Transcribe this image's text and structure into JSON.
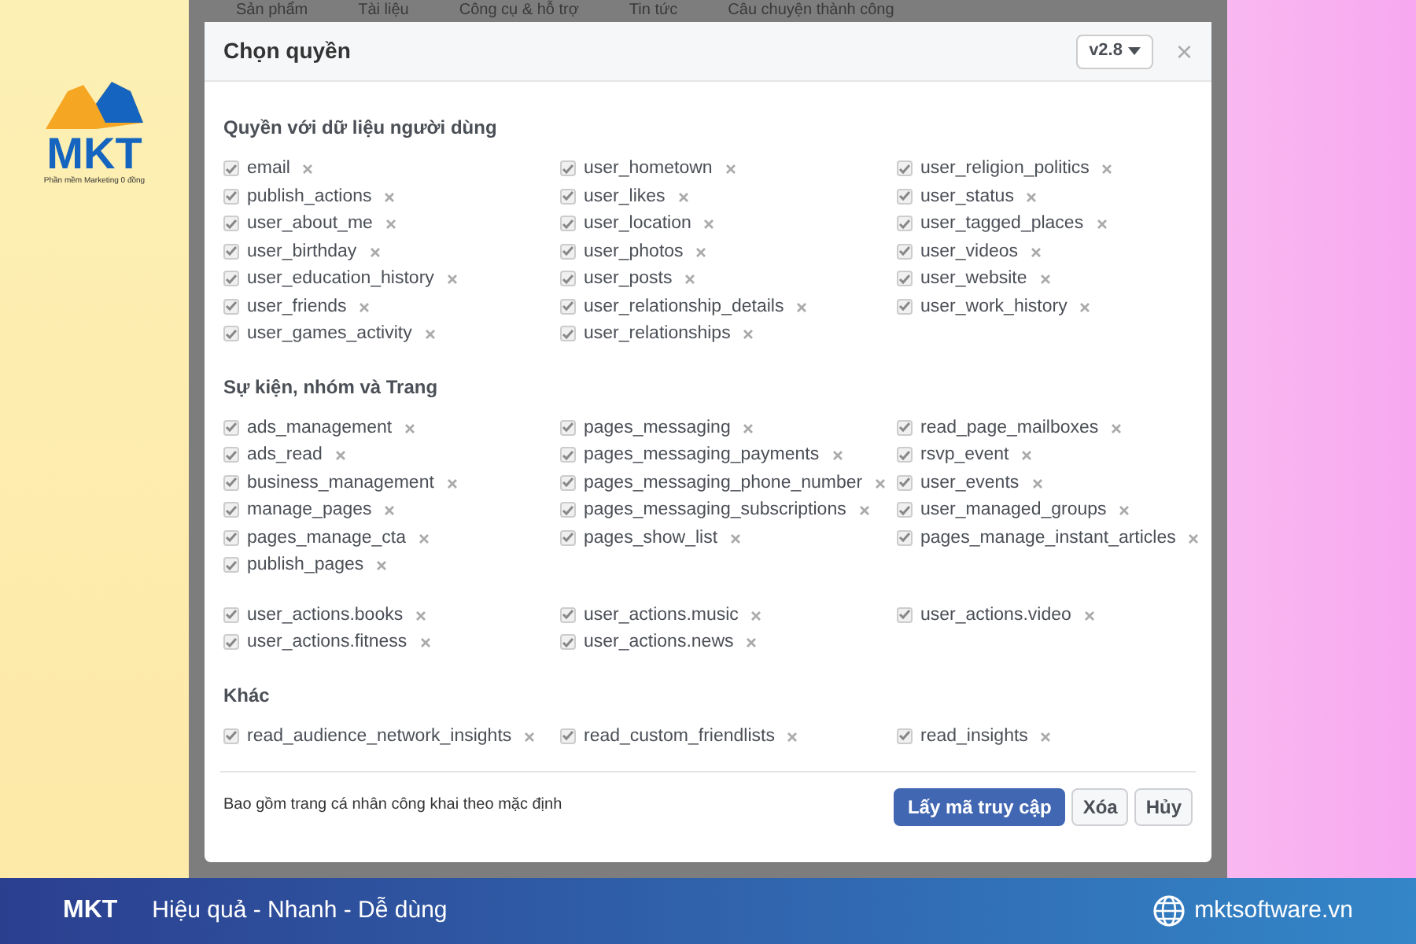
{
  "brand": {
    "logo_text": "MKT",
    "logo_tagline": "Phần mềm Marketing 0 đồng"
  },
  "background_nav": [
    "Sản phẩm",
    "Tài liệu",
    "Công cụ & hỗ trợ",
    "Tin tức",
    "Câu chuyện thành công"
  ],
  "dialog": {
    "title": "Chọn quyền",
    "version": "v2.8",
    "close": "×",
    "sections": [
      {
        "heading": "Quyền với dữ liệu người dùng",
        "items": [
          {
            "label": "email",
            "checked": true
          },
          {
            "label": "user_hometown",
            "checked": true
          },
          {
            "label": "user_religion_politics",
            "checked": true
          },
          {
            "label": "publish_actions",
            "checked": true
          },
          {
            "label": "user_likes",
            "checked": true
          },
          {
            "label": "user_status",
            "checked": true
          },
          {
            "label": "user_about_me",
            "checked": true
          },
          {
            "label": "user_location",
            "checked": true
          },
          {
            "label": "user_tagged_places",
            "checked": true
          },
          {
            "label": "user_birthday",
            "checked": true
          },
          {
            "label": "user_photos",
            "checked": true
          },
          {
            "label": "user_videos",
            "checked": true
          },
          {
            "label": "user_education_history",
            "checked": true
          },
          {
            "label": "user_posts",
            "checked": true
          },
          {
            "label": "user_website",
            "checked": true
          },
          {
            "label": "user_friends",
            "checked": true
          },
          {
            "label": "user_relationship_details",
            "checked": true
          },
          {
            "label": "user_work_history",
            "checked": true
          },
          {
            "label": "user_games_activity",
            "checked": true
          },
          {
            "label": "user_relationships",
            "checked": true
          }
        ]
      },
      {
        "heading": "Sự kiện, nhóm và Trang",
        "items": [
          {
            "label": "ads_management",
            "checked": true
          },
          {
            "label": "pages_messaging",
            "checked": true
          },
          {
            "label": "read_page_mailboxes",
            "checked": true
          },
          {
            "label": "ads_read",
            "checked": true
          },
          {
            "label": "pages_messaging_payments",
            "checked": true
          },
          {
            "label": "rsvp_event",
            "checked": true
          },
          {
            "label": "business_management",
            "checked": true
          },
          {
            "label": "pages_messaging_phone_number",
            "checked": true
          },
          {
            "label": "user_events",
            "checked": true
          },
          {
            "label": "manage_pages",
            "checked": true
          },
          {
            "label": "pages_messaging_subscriptions",
            "checked": true
          },
          {
            "label": "user_managed_groups",
            "checked": true
          },
          {
            "label": "pages_manage_cta",
            "checked": true
          },
          {
            "label": "pages_show_list",
            "checked": true
          },
          {
            "label": "pages_manage_instant_articles",
            "checked": true
          },
          {
            "label": "publish_pages",
            "checked": true
          }
        ]
      },
      {
        "items": [
          {
            "label": "user_actions.books",
            "checked": true
          },
          {
            "label": "user_actions.music",
            "checked": true
          },
          {
            "label": "user_actions.video",
            "checked": true
          },
          {
            "label": "user_actions.fitness",
            "checked": true
          },
          {
            "label": "user_actions.news",
            "checked": true
          }
        ]
      },
      {
        "heading": "Khác",
        "items": [
          {
            "label": "read_audience_network_insights",
            "checked": true
          },
          {
            "label": "read_custom_friendlists",
            "checked": true
          },
          {
            "label": "read_insights",
            "checked": true
          }
        ]
      }
    ],
    "footer_note": "Bao gồm trang cá nhân công khai theo mặc định",
    "buttons": [
      {
        "label": "Lấy mã truy cập",
        "kind": "primary"
      },
      {
        "label": "Xóa",
        "kind": "secondary"
      },
      {
        "label": "Hủy",
        "kind": "secondary"
      }
    ]
  },
  "banner": {
    "logo_text": "MKT",
    "slogan": "Hiệu quả - Nhanh - Dễ dùng",
    "website": "mktsoftware.vn"
  }
}
